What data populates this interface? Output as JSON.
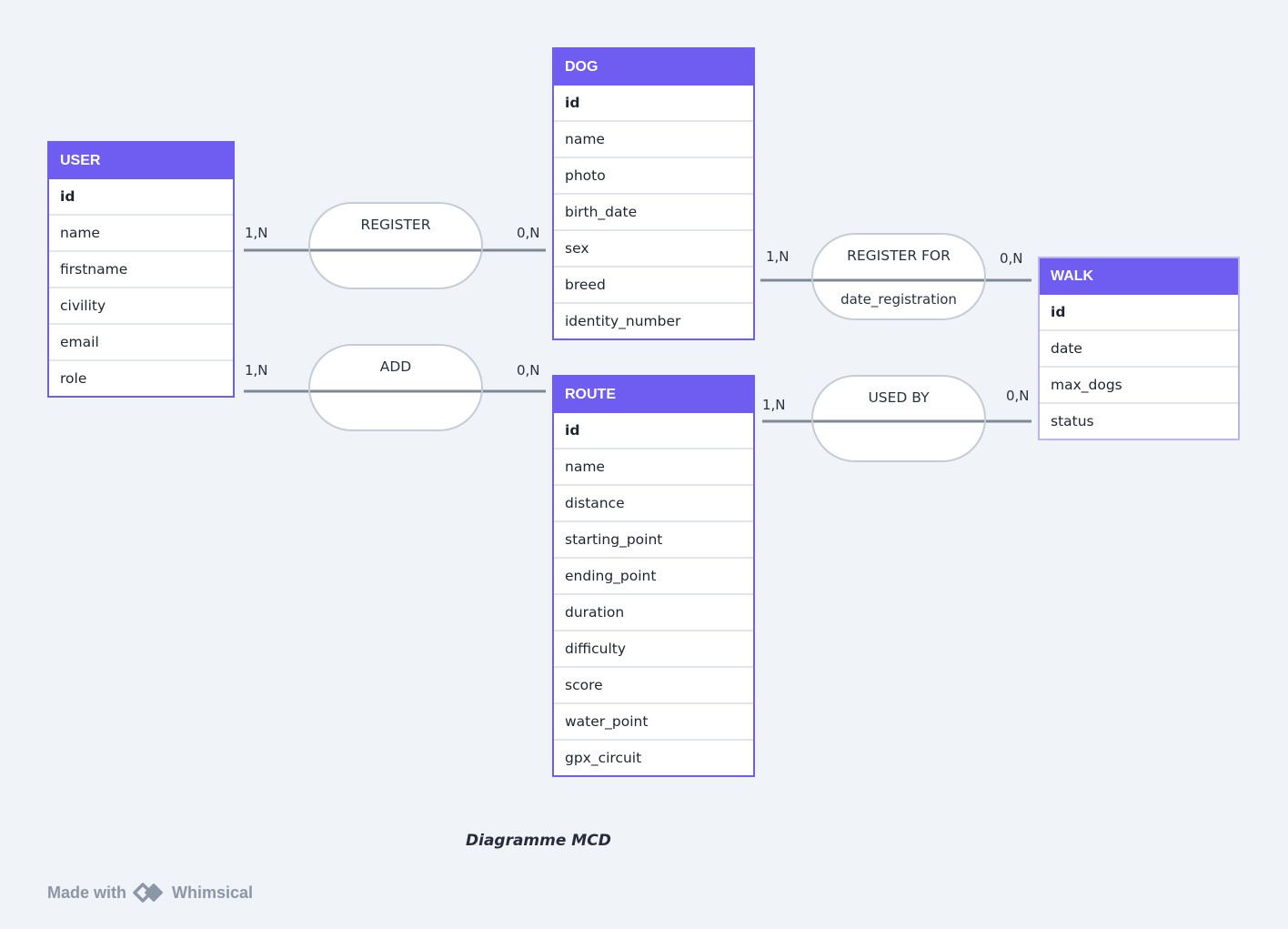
{
  "entities": {
    "user": {
      "title": "USER",
      "fields": [
        "id",
        "name",
        "firstname",
        "civility",
        "email",
        "role"
      ]
    },
    "dog": {
      "title": "DOG",
      "fields": [
        "id",
        "name",
        "photo",
        "birth_date",
        "sex",
        "breed",
        "identity_number"
      ]
    },
    "route": {
      "title": "ROUTE",
      "fields": [
        "id",
        "name",
        "distance",
        "starting_point",
        "ending_point",
        "duration",
        "difficulty",
        "score",
        "water_point",
        "gpx_circuit"
      ]
    },
    "walk": {
      "title": "WALK",
      "fields": [
        "id",
        "date",
        "max_dogs",
        "status"
      ]
    }
  },
  "associations": {
    "register": {
      "name": "REGISTER",
      "attribute": "",
      "left_card": "1,N",
      "right_card": "0,N"
    },
    "add": {
      "name": "ADD",
      "attribute": "",
      "left_card": "1,N",
      "right_card": "0,N"
    },
    "register_for": {
      "name": "REGISTER FOR",
      "attribute": "date_registration",
      "left_card": "1,N",
      "right_card": "0,N"
    },
    "used_by": {
      "name": "USED BY",
      "attribute": "",
      "left_card": "1,N",
      "right_card": "0,N"
    }
  },
  "caption": "Diagramme MCD",
  "footer": {
    "made_with": "Made with",
    "brand": "Whimsical"
  },
  "colors": {
    "accent": "#6f5cf0",
    "line": "#7e8896",
    "background": "#f0f3f7"
  }
}
